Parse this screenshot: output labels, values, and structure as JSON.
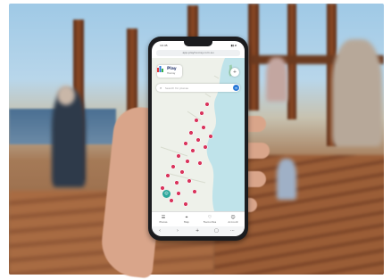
{
  "phone": {
    "status_time": "10:45",
    "status_icons": "▮▮ ▰",
    "url": "app.playhooray.com.au"
  },
  "app": {
    "logo_title": "Play",
    "logo_subtitle": "Hooray",
    "search_placeholder": "Search for places",
    "search_icon": "magnifier",
    "top_button_icon": "plus"
  },
  "bottom_nav": [
    {
      "icon": "list",
      "label": "Places"
    },
    {
      "icon": "map-pin",
      "label": "Map"
    },
    {
      "icon": "heart",
      "label": "Favourites"
    },
    {
      "icon": "user",
      "label": "Account"
    }
  ],
  "browser_bar": [
    "‹",
    "›",
    "+",
    "▢",
    "⋯"
  ],
  "colors": {
    "pin": "#d9345c",
    "accent": "#2b7bd8",
    "locate": "#2aa79b",
    "land": "#eef1ea",
    "water": "#bfe3ea"
  }
}
